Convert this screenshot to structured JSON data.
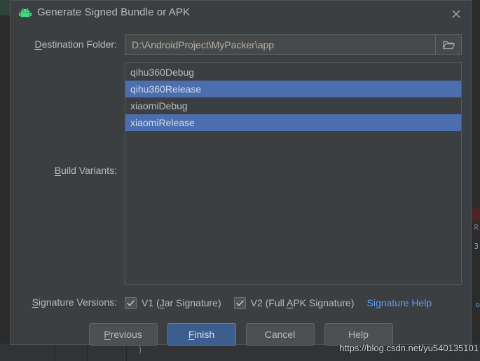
{
  "dialog": {
    "title": "Generate Signed Bundle or APK",
    "title_icon": "android-robot-icon",
    "close_icon": "close-icon"
  },
  "destination": {
    "label_mnemonic": "D",
    "label_rest": "estination Folder:",
    "value": "D:\\AndroidProject\\MyPacker\\app",
    "browse_icon": "folder-open-icon"
  },
  "build_variants": {
    "label_mnemonic": "B",
    "label_rest": "uild Variants:",
    "items": [
      {
        "label": "qihu360Debug",
        "selected": false
      },
      {
        "label": "qihu360Release",
        "selected": true
      },
      {
        "label": "xiaomiDebug",
        "selected": false
      },
      {
        "label": "xiaomiRelease",
        "selected": true
      }
    ]
  },
  "signature_versions": {
    "label_mnemonic": "S",
    "label_rest": "ignature Versions:",
    "checkboxes": [
      {
        "prefix": "V1 (",
        "mnemonic": "J",
        "suffix": "ar Signature)",
        "checked": true
      },
      {
        "prefix": "V2 (Full ",
        "mnemonic": "A",
        "suffix": "PK Signature)",
        "checked": true
      }
    ],
    "help_link": "Signature Help"
  },
  "buttons": [
    {
      "mnemonic": "P",
      "rest": "revious",
      "default": false
    },
    {
      "mnemonic": "F",
      "rest": "inish",
      "default": true
    },
    {
      "mnemonic": "",
      "rest": "Cancel",
      "default": false
    },
    {
      "mnemonic": "",
      "rest": "Help",
      "default": false
    }
  ],
  "watermark": "https://blog.csdn.net/yu540135101",
  "background": {
    "code_fragments": [
      "R",
      "3"
    ],
    "blue_fragment": "o",
    "bottom_glyph": ")"
  },
  "colors": {
    "dialog_bg": "#3c3f41",
    "selection": "#4b6eaf",
    "link": "#589df6",
    "default_button": "#3c5e8e",
    "android_green": "#3ddc84",
    "text": "#bbbbbb",
    "field_text": "#b9b0a6"
  }
}
